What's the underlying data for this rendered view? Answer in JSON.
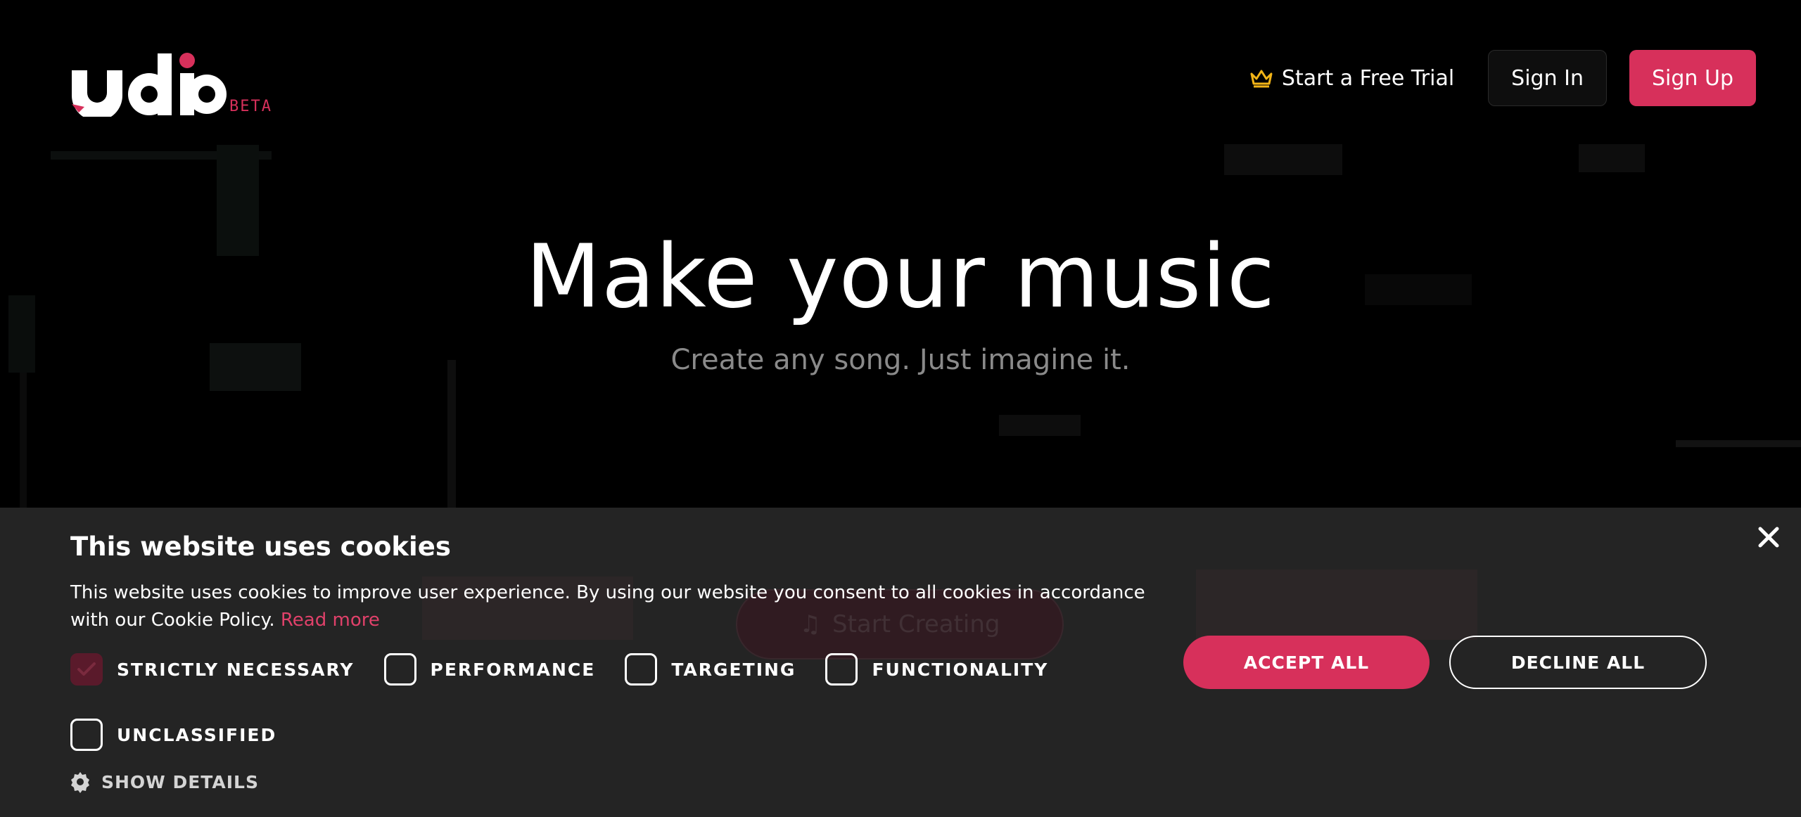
{
  "brand": {
    "logo_text": "udio",
    "badge": "BETA",
    "accent_color": "#d7305b"
  },
  "nav": {
    "trial_label": "Start a Free Trial",
    "trial_icon": "crown-icon",
    "signin_label": "Sign In",
    "signup_label": "Sign Up"
  },
  "hero": {
    "title": "Make your music",
    "subtitle": "Create any song. Just imagine it.",
    "cta_label": "Start Creating",
    "cta_icon": "music-note-icon"
  },
  "cookie_banner": {
    "title": "This website uses cookies",
    "text": "This website uses cookies to improve user experience. By using our website you consent to all cookies in accordance with our Cookie Policy.",
    "read_more": "Read more",
    "categories": [
      {
        "label": "STRICTLY NECESSARY",
        "checked": true
      },
      {
        "label": "PERFORMANCE",
        "checked": false
      },
      {
        "label": "TARGETING",
        "checked": false
      },
      {
        "label": "FUNCTIONALITY",
        "checked": false
      },
      {
        "label": "UNCLASSIFIED",
        "checked": false
      }
    ],
    "show_details": "SHOW DETAILS",
    "accept_label": "ACCEPT ALL",
    "decline_label": "DECLINE ALL",
    "close_icon": "close-icon"
  }
}
